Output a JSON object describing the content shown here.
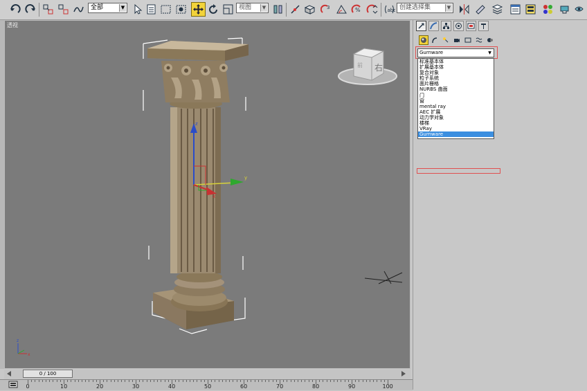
{
  "toolbar": {
    "selection_filter": "全部",
    "ref_coord": "视图",
    "named_selection_placeholder": "创建选择集"
  },
  "viewport": {
    "label": "透视",
    "viewcube_face": "右",
    "viewcube_side": "前"
  },
  "command_panel": {
    "category_selected": "Gurnware",
    "category_options": [
      "标准基本体",
      "扩展基本体",
      "复合对象",
      "粒子系统",
      "面片栅格",
      "NURBS 曲面",
      "门",
      "窗",
      "mental ray",
      "AEC 扩展",
      "动力学对象",
      "楼梯",
      "VRay",
      "Gurnware"
    ],
    "highlighted_option": "Gurnware"
  },
  "timeline": {
    "frame_display": "0 / 100",
    "ticks": [
      "0",
      "10",
      "20",
      "30",
      "40",
      "50",
      "60",
      "70",
      "80",
      "90",
      "100"
    ]
  },
  "gizmo": {
    "axis_x": "x",
    "axis_y": "y",
    "axis_z": "z"
  },
  "colors": {
    "viewport_bg": "#7b7b7b",
    "active_tool": "#f2d33a",
    "highlight": "#3c8fe0",
    "annotation_red": "#e05050"
  }
}
